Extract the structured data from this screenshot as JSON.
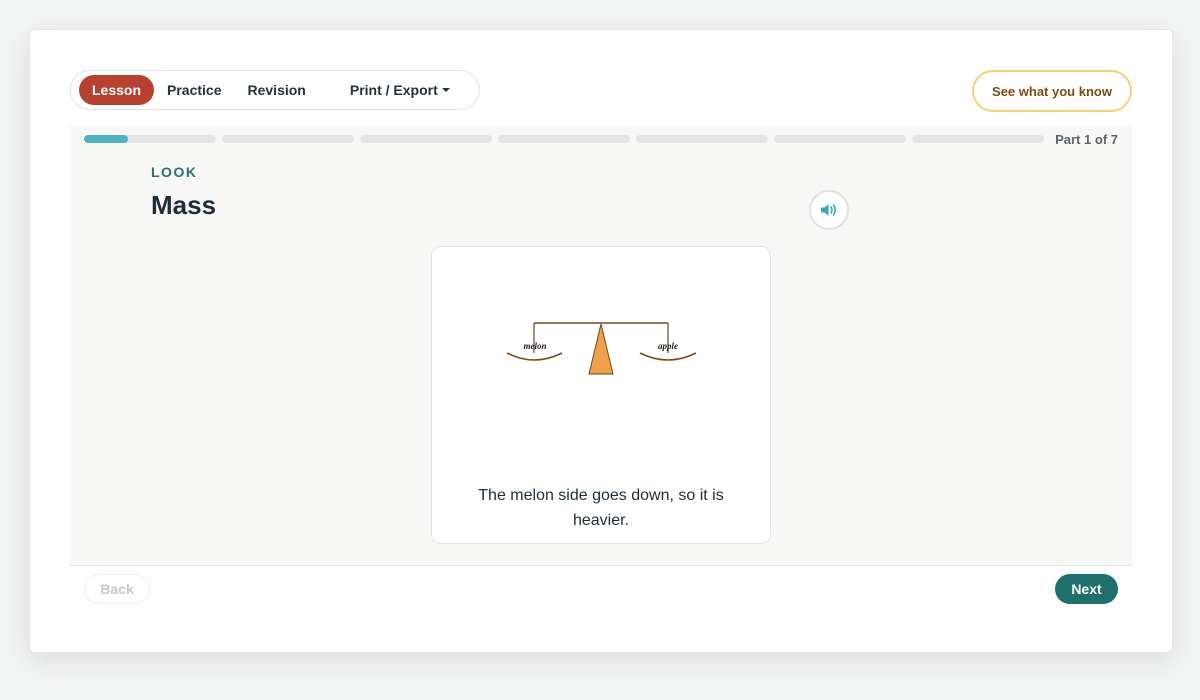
{
  "nav": {
    "tabs": [
      {
        "label": "Lesson",
        "active": true
      },
      {
        "label": "Practice",
        "active": false
      },
      {
        "label": "Revision",
        "active": false
      }
    ],
    "print_label": "Print / Export",
    "see_what_you_know_label": "See what you know"
  },
  "progress": {
    "segments": 7,
    "current_fraction": 0.33,
    "label": "Part 1 of 7"
  },
  "lesson": {
    "eyebrow": "LOOK",
    "title": "Mass",
    "audio_icon": "speaker-icon",
    "image": {
      "left_label": "melon",
      "right_label": "apple"
    },
    "caption": "The melon side goes down, so it is heavier."
  },
  "footer": {
    "back_label": "Back",
    "next_label": "Next"
  },
  "colors": {
    "active_tab": "#b74130",
    "accent_teal": "#1f6f6c",
    "progress_fill": "#4db3c1",
    "see_btn_border": "#f2d277",
    "fulcrum": "#f0a04a"
  }
}
